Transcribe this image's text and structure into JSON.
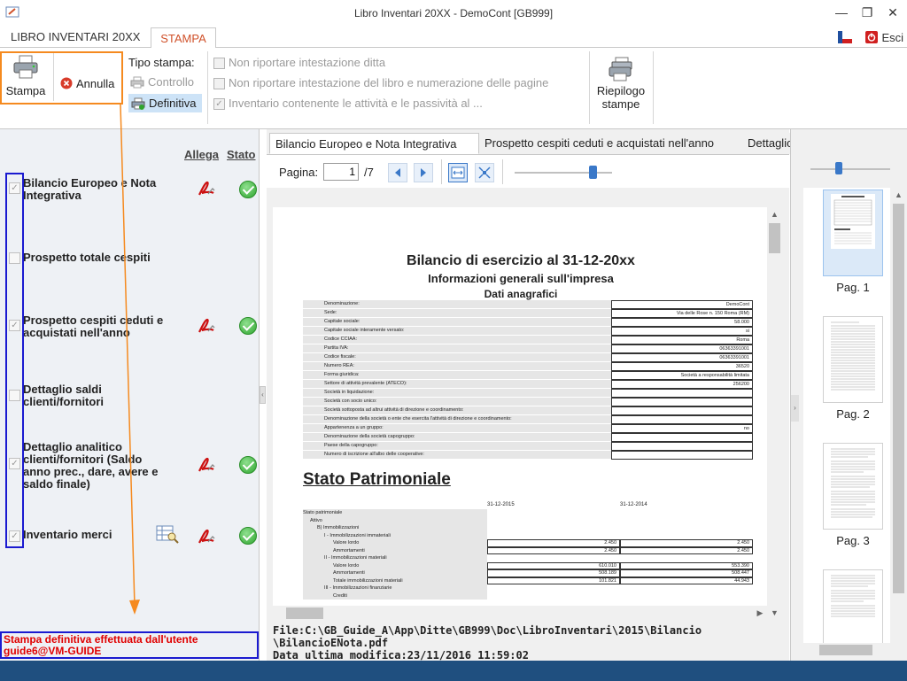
{
  "window": {
    "title": "Libro Inventari 20XX - DemoCont [GB999]",
    "esci_label": "Esci"
  },
  "ribbon_tabs": [
    {
      "label": "LIBRO INVENTARI 20XX"
    },
    {
      "label": "STAMPA"
    }
  ],
  "ribbon": {
    "stampa_label": "Stampa",
    "annulla_label": "Annulla",
    "tipo_stampa_label": "Tipo stampa:",
    "controllo_label": "Controllo",
    "definitiva_label": "Definitiva",
    "option1": "Non riportare intestazione ditta",
    "option2": "Non riportare intestazione del libro e numerazione delle pagine",
    "option3": "Inventario contenente le attività e le passività al ...",
    "riepilogo_label": "Riepilogo stampe"
  },
  "left_panel": {
    "allega_header": "Allega",
    "stato_header": "Stato",
    "items": [
      {
        "label": "Bilancio Europeo e Nota Integrativa",
        "checked": true
      },
      {
        "label": "Prospetto totale cespiti",
        "checked": false
      },
      {
        "label": "Prospetto cespiti ceduti e acquistati nell'anno",
        "checked": true
      },
      {
        "label": "Dettaglio saldi clienti/fornitori",
        "checked": false
      },
      {
        "label": "Dettaglio analitico clienti/fornitori (Saldo anno prec., dare, avere e saldo finale)",
        "checked": true
      },
      {
        "label": "Inventario merci",
        "checked": true
      }
    ],
    "message": "Stampa definitiva effettuata dall'utente guide6@VM-GUIDE"
  },
  "doc_tabs": [
    {
      "label": "Bilancio Europeo e Nota Integrativa"
    },
    {
      "label": "Prospetto cespiti ceduti e acquistati nell'anno"
    },
    {
      "label": "Dettaglio analitico clienti"
    }
  ],
  "pager": {
    "label": "Pagina:",
    "value": "1",
    "total": "/7",
    "zoom_percent": 80
  },
  "document": {
    "title": "Bilancio di esercizio al 31-12-20xx",
    "subtitle": "Informazioni generali sull'impresa",
    "section": "Dati anagrafici",
    "anagrafica": [
      {
        "label": "Denominazione:",
        "value": "DemoCont"
      },
      {
        "label": "Sede:",
        "value": "Via delle Rose n. 150 Roma (RM)"
      },
      {
        "label": "Capitale sociale:",
        "value": "58.000"
      },
      {
        "label": "Capitale sociale interamente versato:",
        "value": "si"
      },
      {
        "label": "Codice CCIAA:",
        "value": "Roma"
      },
      {
        "label": "Partita IVA:",
        "value": "06363391001"
      },
      {
        "label": "Codice fiscale:",
        "value": "06363391001"
      },
      {
        "label": "Numero REA:",
        "value": "36520"
      },
      {
        "label": "Forma giuridica:",
        "value": "Società a responsabilità limitata"
      },
      {
        "label": "Settore di attività prevalente (ATECO):",
        "value": "256200"
      },
      {
        "label": "Società in liquidazione:",
        "value": ""
      },
      {
        "label": "Società con socio unico:",
        "value": ""
      },
      {
        "label": "Società sottoposta ad altrui attività di direzione e coordinamento:",
        "value": ""
      },
      {
        "label": "Denominazione della società o ente che esercita l'attività di direzione e coordinamento:",
        "value": ""
      },
      {
        "label": "Appartenenza a un gruppo:",
        "value": "no"
      },
      {
        "label": "Denominazione della società capogruppo:",
        "value": ""
      },
      {
        "label": "Paese della capogruppo:",
        "value": ""
      },
      {
        "label": "Numero di iscrizione all'albo delle cooperative:",
        "value": ""
      }
    ],
    "sp_title": "Stato Patrimoniale",
    "col1": "31-12-2015",
    "col2": "31-12-2014",
    "sp_rows": [
      {
        "label": "Stato patrimoniale",
        "v1": "",
        "v2": ""
      },
      {
        "label": "Attivo",
        "v1": "",
        "v2": ""
      },
      {
        "label": "B) Immobilizzazioni",
        "v1": "",
        "v2": ""
      },
      {
        "label": "I - Immobilizzazioni immateriali",
        "v1": "",
        "v2": ""
      },
      {
        "label": "Valore lordo",
        "v1": "2.450",
        "v2": "2.450"
      },
      {
        "label": "Ammortamenti",
        "v1": "2.450",
        "v2": "2.450"
      },
      {
        "label": "II - Immobilizzazioni materiali",
        "v1": "",
        "v2": ""
      },
      {
        "label": "Valore lordo",
        "v1": "610.010",
        "v2": "553.390"
      },
      {
        "label": "Ammortamenti",
        "v1": "508.189",
        "v2": "508.447"
      },
      {
        "label": "Totale immobilizzazioni materiali",
        "v1": "101.821",
        "v2": "44.943"
      },
      {
        "label": "III - Immobilizzazioni finanziarie",
        "v1": "",
        "v2": ""
      },
      {
        "label": "Crediti",
        "v1": "",
        "v2": ""
      }
    ]
  },
  "file_info": {
    "line1": "File:C:\\GB_Guide_A\\App\\Ditte\\GB999\\Doc\\LibroInventari\\2015\\Bilancio",
    "line2": "\\BilancioENota.pdf",
    "line3": "Data ultima modifica:23/11/2016 11:59:02"
  },
  "thumbnails": [
    {
      "label": "Pag. 1"
    },
    {
      "label": "Pag. 2"
    },
    {
      "label": "Pag. 3"
    }
  ],
  "colors": {
    "accent_tab": "#d0512a",
    "highlight_orange": "#f58a1f",
    "highlight_blue": "#1a1ad0",
    "message_red": "#e00000",
    "status_bar": "#1f4f7f"
  }
}
